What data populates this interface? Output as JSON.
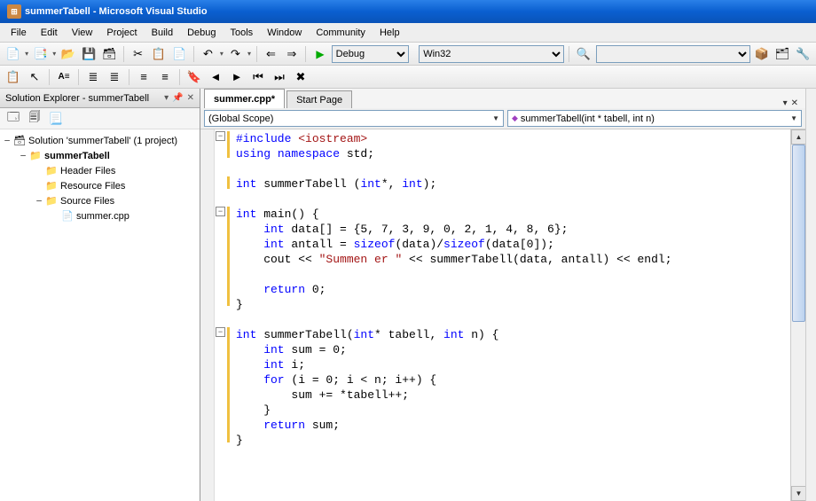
{
  "titlebar": {
    "text": "summerTabell - Microsoft Visual Studio"
  },
  "menubar": [
    "File",
    "Edit",
    "View",
    "Project",
    "Build",
    "Debug",
    "Tools",
    "Window",
    "Community",
    "Help"
  ],
  "toolbar": {
    "config_label": "Debug",
    "platform_label": "Win32"
  },
  "sidebar": {
    "title": "Solution Explorer - summerTabell",
    "solution_label": "Solution 'summerTabell' (1 project)",
    "project": "summerTabell",
    "folder_headers": "Header Files",
    "folder_resources": "Resource Files",
    "folder_sources": "Source Files",
    "file_summer": "summer.cpp"
  },
  "tabs": {
    "active": "summer.cpp*",
    "second": "Start Page"
  },
  "scope": {
    "left": "(Global Scope)",
    "right": "summerTabell(int * tabell, int n)"
  },
  "code": {
    "l1a": "#include ",
    "l1b": "<iostream>",
    "l2a": "using",
    "l2b": " namespace",
    " l2c": " std;",
    "l4a": "int",
    " l4b": " summerTabell (",
    "l4c": "int",
    "l4d": "*, ",
    "l4e": "int",
    "l4f": ");",
    "l6a": "int",
    " l6b": " main() {",
    "l7a": "    int",
    " l7b": " data[] = {5, 7, 3, 9, 0, 2, 1, 4, 8, 6};",
    "l8a": "    int",
    " l8b": " antall = ",
    "l8c": "sizeof",
    "l8d": "(data)/",
    "l8e": "sizeof",
    "l8f": "(data[0]);",
    "l9a": "    cout << ",
    "l9b": "\"Summen er \"",
    "l9c": " << summerTabell(data, antall) << endl;",
    "l11a": "    return",
    " l11b": " 0;",
    "l12": "}",
    "l14a": "int",
    " l14b": " summerTabell(",
    "l14c": "int",
    "l14d": "* tabell, ",
    "l14e": "int",
    "l14f": " n) {",
    "l15a": "    int",
    " l15b": " sum = 0;",
    "l16a": "    int",
    " l16b": " i;",
    "l17a": "    for",
    " l17b": " (i = 0; i < n; i++) {",
    "l18": "        sum += *tabell++;",
    "l19": "    }",
    "l20a": "    return",
    " l20b": " sum;",
    "l21": "}"
  }
}
